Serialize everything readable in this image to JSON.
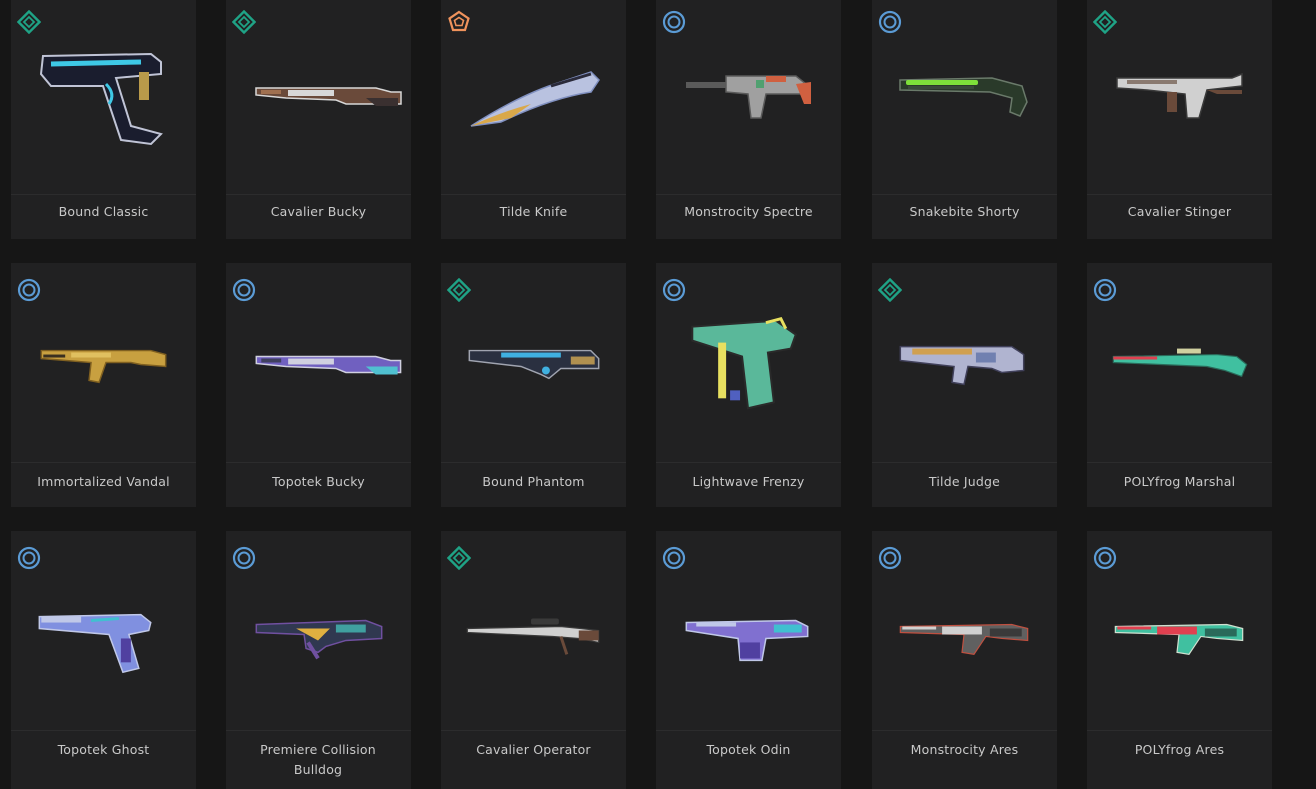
{
  "colors": {
    "background": "#161616",
    "card": "#212122",
    "text": "#c9c9c9",
    "tier_select": "#5b9bd5",
    "tier_deluxe": "#1fa386",
    "tier_exclusive": "#f0935c"
  },
  "skins": [
    {
      "name": "Bound Classic",
      "tier": "deluxe",
      "weapon": "pistol-heavy",
      "palette": [
        "#1a1d2e",
        "#c0c4d6",
        "#3ec8e6",
        "#b99a4a"
      ]
    },
    {
      "name": "Cavalier Bucky",
      "tier": "deluxe",
      "weapon": "shotgun",
      "palette": [
        "#6a4a3a",
        "#d8d8d8",
        "#3a3030",
        "#a07050"
      ]
    },
    {
      "name": "Tilde Knife",
      "tier": "exclusive",
      "weapon": "knife",
      "palette": [
        "#b9c2e0",
        "#2a2a3a",
        "#d9a84a",
        "#8090c0"
      ]
    },
    {
      "name": "Monstrocity Spectre",
      "tier": "select",
      "weapon": "smg",
      "palette": [
        "#5a5a5a",
        "#d06040",
        "#50a070",
        "#a0a0a0"
      ]
    },
    {
      "name": "Snakebite Shorty",
      "tier": "select",
      "weapon": "shorty",
      "palette": [
        "#2a3a2a",
        "#7ee03a",
        "#6a7a6a",
        "#3a4a3a"
      ]
    },
    {
      "name": "Cavalier Stinger",
      "tier": "deluxe",
      "weapon": "stinger",
      "palette": [
        "#8a7a70",
        "#d0d0d0",
        "#6a4a3a",
        "#3a3a3a"
      ]
    },
    {
      "name": "Immortalized Vandal",
      "tier": "select",
      "weapon": "rifle",
      "palette": [
        "#c8a040",
        "#3a3020",
        "#e0c060",
        "#806020"
      ]
    },
    {
      "name": "Topotek Bucky",
      "tier": "select",
      "weapon": "shotgun",
      "palette": [
        "#7060c0",
        "#d0d0e0",
        "#50c0d0",
        "#404060"
      ]
    },
    {
      "name": "Bound Phantom",
      "tier": "deluxe",
      "weapon": "phantom",
      "palette": [
        "#2a3040",
        "#a0a4b0",
        "#40b0e0",
        "#b09050"
      ]
    },
    {
      "name": "Lightwave Frenzy",
      "tier": "select",
      "weapon": "frenzy",
      "palette": [
        "#5ab89a",
        "#e8e060",
        "#2a2a2a",
        "#5060c0"
      ]
    },
    {
      "name": "Tilde Judge",
      "tier": "deluxe",
      "weapon": "judge",
      "palette": [
        "#b0b4d0",
        "#40405a",
        "#d0a050",
        "#7080b0"
      ]
    },
    {
      "name": "POLYfrog Marshal",
      "tier": "select",
      "weapon": "marshal",
      "palette": [
        "#e04050",
        "#40c0a0",
        "#d0d0a0",
        "#2a6a5a"
      ]
    },
    {
      "name": "Topotek Ghost",
      "tier": "select",
      "weapon": "pistol",
      "palette": [
        "#8090e0",
        "#c0c8e8",
        "#5040a0",
        "#40c0d0"
      ]
    },
    {
      "name": "Premiere Collision Bulldog",
      "tier": "select",
      "weapon": "bulldog",
      "palette": [
        "#303850",
        "#e0b040",
        "#7050a0",
        "#40a0a0"
      ]
    },
    {
      "name": "Cavalier Operator",
      "tier": "deluxe",
      "weapon": "sniper",
      "palette": [
        "#8a7a70",
        "#d0d0d0",
        "#6a4a3a",
        "#3a3a3a"
      ]
    },
    {
      "name": "Topotek Odin",
      "tier": "select",
      "weapon": "odin",
      "palette": [
        "#8070d0",
        "#c0c8e8",
        "#5040a0",
        "#40c0d0"
      ]
    },
    {
      "name": "Monstrocity Ares",
      "tier": "select",
      "weapon": "ares",
      "palette": [
        "#606060",
        "#d0d0d0",
        "#c05040",
        "#3a3a3a"
      ]
    },
    {
      "name": "POLYfrog Ares",
      "tier": "select",
      "weapon": "ares",
      "palette": [
        "#40c0a0",
        "#e04050",
        "#d0e0d0",
        "#2a6a5a"
      ]
    }
  ]
}
